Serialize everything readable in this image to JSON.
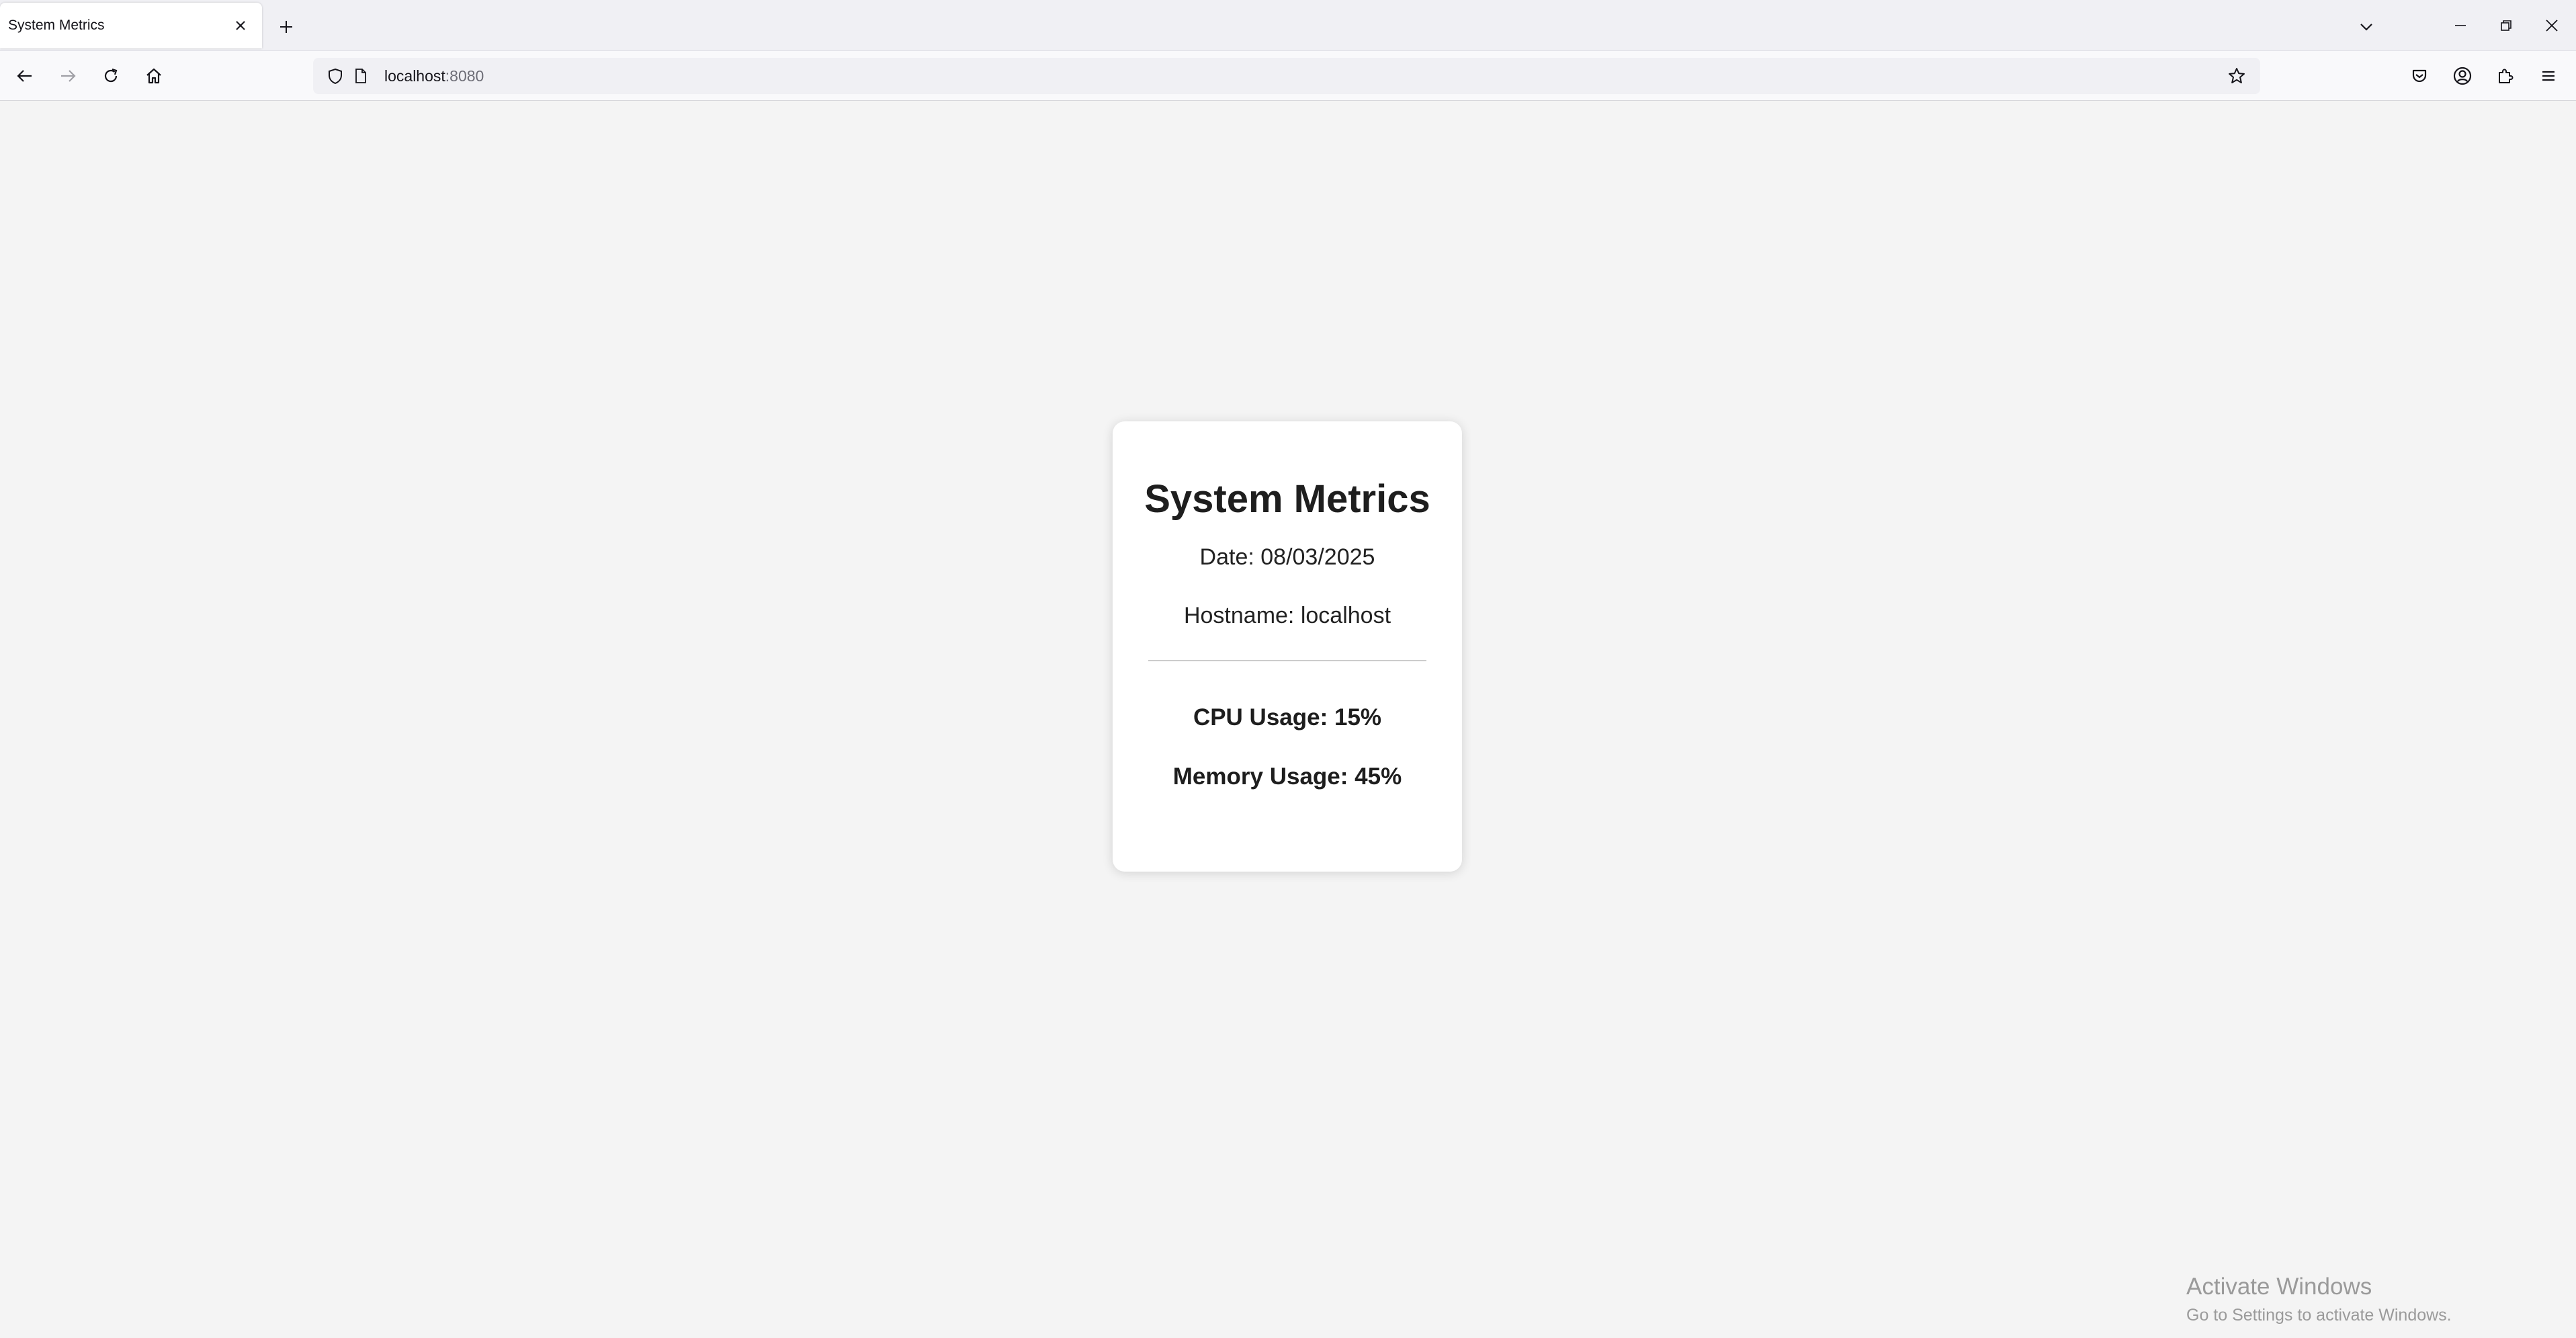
{
  "browser": {
    "tab": {
      "title": "System Metrics"
    },
    "url": {
      "host": "localhost",
      "port": ":8080"
    }
  },
  "icons": {
    "tab_close": "close-icon",
    "new_tab": "plus-icon",
    "tab_list": "chevron-down-icon",
    "minimize": "minimize-icon",
    "restore": "restore-icon",
    "close_window": "close-icon",
    "back": "arrow-left-icon",
    "forward": "arrow-right-icon",
    "reload": "reload-icon",
    "home": "home-icon",
    "shield": "shield-icon",
    "page": "page-icon",
    "bookmark": "star-icon",
    "pocket": "pocket-icon",
    "account": "account-icon",
    "extensions": "puzzle-icon",
    "menu": "hamburger-menu-icon"
  },
  "card": {
    "title": "System Metrics",
    "date": "Date: 08/03/2025",
    "hostname": "Hostname: localhost",
    "cpu": "CPU Usage: 15%",
    "memory": "Memory Usage: 45%"
  },
  "watermark": {
    "title": "Activate Windows",
    "subtitle": "Go to Settings to activate Windows."
  },
  "colors": {
    "page_background": "#f4f4f4",
    "card_background": "#ffffff",
    "text": "#222222"
  }
}
